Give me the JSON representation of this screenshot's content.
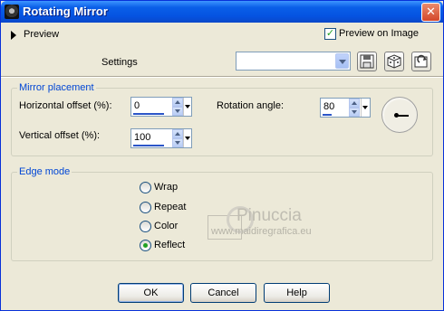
{
  "window": {
    "title": "Rotating Mirror",
    "close_glyph": "✕"
  },
  "header": {
    "preview_label": "Preview",
    "preview_on_image": {
      "label": "Preview on Image",
      "checked": true
    },
    "settings_label": "Settings",
    "settings_value": "",
    "tool_buttons": [
      "save-preset-icon",
      "randomize-dice-icon",
      "reset-icon"
    ]
  },
  "mirror_placement": {
    "legend": "Mirror placement",
    "horizontal_offset": {
      "label": "Horizontal offset (%):",
      "value": "0"
    },
    "vertical_offset": {
      "label": "Vertical offset (%):",
      "value": "100"
    },
    "rotation_angle": {
      "label": "Rotation angle:",
      "value": "80"
    }
  },
  "edge_mode": {
    "legend": "Edge mode",
    "options": [
      {
        "label": "Wrap",
        "checked": false
      },
      {
        "label": "Repeat",
        "checked": false
      },
      {
        "label": "Color",
        "checked": false
      },
      {
        "label": "Reflect",
        "checked": true
      }
    ]
  },
  "watermark": {
    "name": "Pinuccia",
    "url": "www.maidiregrafica.eu"
  },
  "buttons": {
    "ok": "OK",
    "cancel": "Cancel",
    "help": "Help"
  },
  "colors": {
    "titlebar": "#0553E1",
    "group_legend": "#0046D5",
    "background": "#ECE9D8",
    "check_mark": "#21A121"
  }
}
